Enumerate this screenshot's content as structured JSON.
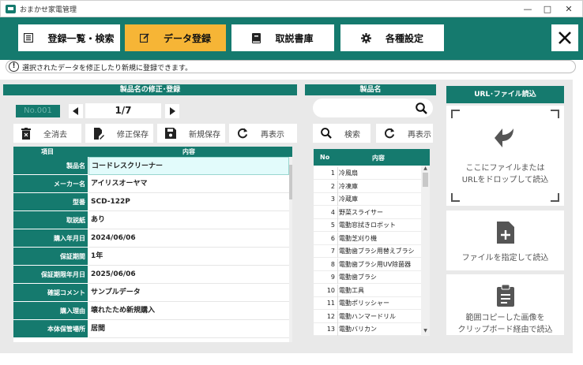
{
  "window": {
    "title": "おまかせ家電管理",
    "buttons": [
      "—",
      "□",
      "✕"
    ]
  },
  "nav": {
    "tabs": [
      {
        "label": "登録一覧・検索",
        "icon": "list-icon",
        "active": false
      },
      {
        "label": "データ登録",
        "icon": "edit-icon",
        "active": true
      },
      {
        "label": "取説書庫",
        "icon": "book-icon",
        "active": false
      },
      {
        "label": "各種設定",
        "icon": "gear-icon",
        "active": false
      }
    ],
    "close_label": "✕"
  },
  "info": {
    "icon": "!",
    "text": "選択されたデータを修正したり新規に登録できます。"
  },
  "left": {
    "header": "製品名の修正･登録",
    "no_badge": "No.001",
    "pager": "1/7",
    "buttons": {
      "clear": "全消去",
      "update": "修正保存",
      "new": "新規保存",
      "refresh": "再表示"
    },
    "table": {
      "col_item": "項目",
      "col_content": "内容",
      "rows": [
        {
          "label": "製品名",
          "value": "コードレスクリーナー"
        },
        {
          "label": "メーカー名",
          "value": "アイリスオーヤマ"
        },
        {
          "label": "型番",
          "value": "SCD-122P"
        },
        {
          "label": "取説紙",
          "value": "あり"
        },
        {
          "label": "購入年月日",
          "value": "2024/06/06"
        },
        {
          "label": "保証期間",
          "value": "1年"
        },
        {
          "label": "保証期限年月日",
          "value": "2025/06/06"
        },
        {
          "label": "確認コメント",
          "value": "サンプルデータ"
        },
        {
          "label": "購入理由",
          "value": "壊れたため新規購入"
        },
        {
          "label": "本体保管場所",
          "value": "居間"
        }
      ]
    }
  },
  "middle": {
    "header": "製品名",
    "search_placeholder": "",
    "buttons": {
      "search": "検索",
      "refresh": "再表示"
    },
    "list": {
      "col_no": "No",
      "col_content": "内容",
      "rows": [
        {
          "no": "1",
          "name": "冷風扇"
        },
        {
          "no": "2",
          "name": "冷凍庫"
        },
        {
          "no": "3",
          "name": "冷蔵庫"
        },
        {
          "no": "4",
          "name": "野菜スライサー"
        },
        {
          "no": "5",
          "name": "電動窓拭きロボット"
        },
        {
          "no": "6",
          "name": "電動芝刈り機"
        },
        {
          "no": "7",
          "name": "電動歯ブラシ用替えブラシ"
        },
        {
          "no": "8",
          "name": "電動歯ブラシ用UV除菌器"
        },
        {
          "no": "9",
          "name": "電動歯ブラシ"
        },
        {
          "no": "10",
          "name": "電動工具"
        },
        {
          "no": "11",
          "name": "電動ポリッシャー"
        },
        {
          "no": "12",
          "name": "電動ハンマードリル"
        },
        {
          "no": "13",
          "name": "電動バリカン"
        }
      ]
    }
  },
  "right": {
    "header": "URL･ファイル読込",
    "drop": {
      "line1": "ここにファイルまたは",
      "line2": "URLをドロップして読込"
    },
    "file": "ファイルを指定して読込",
    "clip": {
      "line1": "範囲コピーした画像を",
      "line2": "クリップボード経由で読込"
    }
  },
  "colors": {
    "teal": "#157a6e",
    "accent": "#f6b536",
    "panel": "#e9e9e9"
  }
}
